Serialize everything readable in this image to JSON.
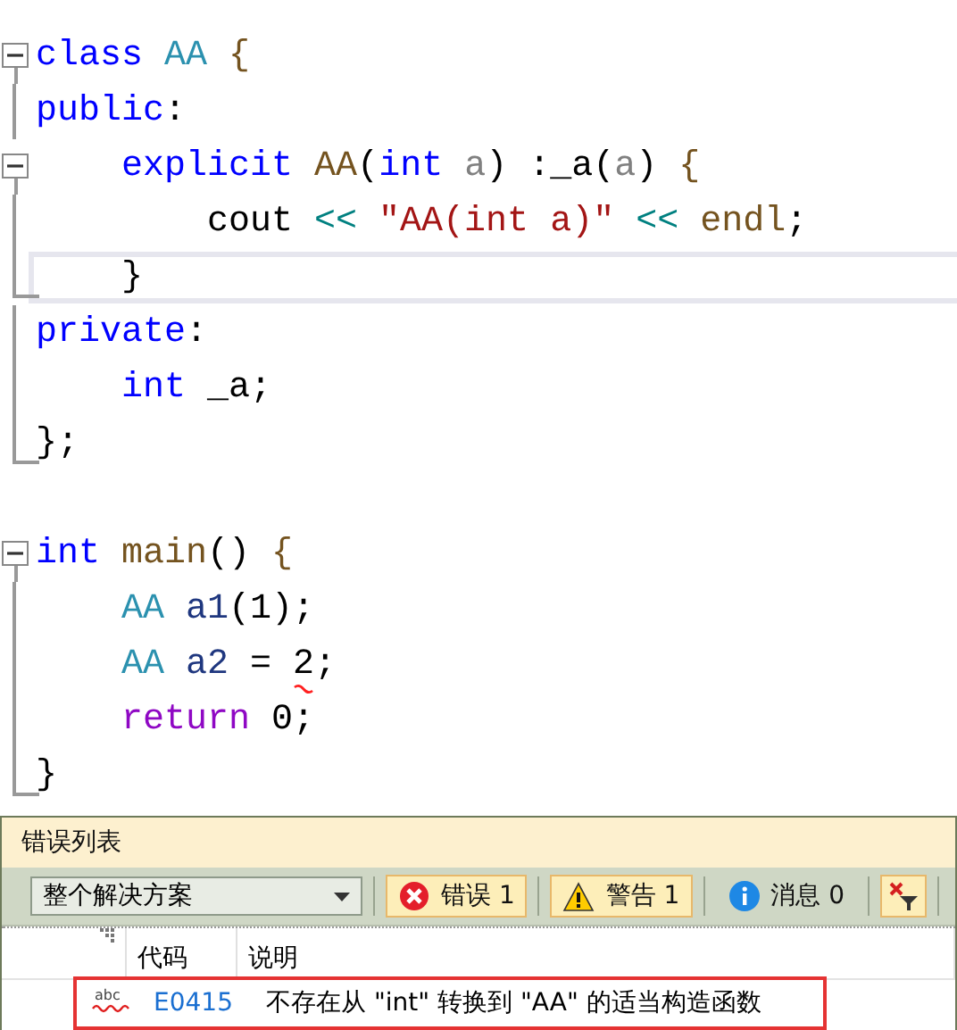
{
  "code": {
    "lines": [
      {
        "kind": "fold_start",
        "current": false,
        "tokens": [
          {
            "text": "class",
            "kind": "keyword"
          },
          {
            "text": " AA",
            "kind": "type"
          },
          {
            "text": " {",
            "kind": "func"
          }
        ]
      },
      {
        "kind": "fold_body",
        "current": false,
        "tokens": [
          {
            "text": "public",
            "kind": "keyword"
          },
          {
            "text": ":"
          }
        ]
      },
      {
        "kind": "fold_start",
        "current": false,
        "tokens": [
          {
            "text": "    explicit",
            "kind": "keyword"
          },
          {
            "text": " AA",
            "kind": "func"
          },
          {
            "text": "("
          },
          {
            "text": "int",
            "kind": "keyword"
          },
          {
            "text": " a",
            "kind": "param"
          },
          {
            "text": ") :_a("
          },
          {
            "text": "a",
            "kind": "param"
          },
          {
            "text": ") "
          },
          {
            "text": "{",
            "kind": "func"
          }
        ]
      },
      {
        "kind": "fold_body",
        "current": false,
        "tokens": [
          {
            "text": "        cout "
          },
          {
            "text": "<<",
            "kind": "operator"
          },
          {
            "text": " \"AA(int a)\"",
            "kind": "string"
          },
          {
            "text": " <<",
            "kind": "operator"
          },
          {
            "text": " endl",
            "kind": "func"
          },
          {
            "text": ";"
          }
        ]
      },
      {
        "kind": "fold_end",
        "current": true,
        "tokens": [
          {
            "text": "    }"
          }
        ]
      },
      {
        "kind": "fold_body",
        "current": false,
        "tokens": [
          {
            "text": "private",
            "kind": "keyword"
          },
          {
            "text": ":"
          }
        ]
      },
      {
        "kind": "fold_body",
        "current": false,
        "tokens": [
          {
            "text": "    int",
            "kind": "keyword"
          },
          {
            "text": " _a;"
          }
        ]
      },
      {
        "kind": "fold_end",
        "current": false,
        "tokens": [
          {
            "text": "};"
          }
        ]
      },
      {
        "kind": "plain",
        "current": false
      },
      {
        "kind": "fold_start",
        "current": false,
        "tokens": [
          {
            "text": "int",
            "kind": "keyword"
          },
          {
            "text": " main",
            "kind": "func"
          },
          {
            "text": "() "
          },
          {
            "text": "{",
            "kind": "func"
          }
        ]
      },
      {
        "kind": "fold_body",
        "current": false,
        "tokens": [
          {
            "text": "    AA",
            "kind": "type"
          },
          {
            "text": " a1",
            "kind": "var"
          },
          {
            "text": "(1);"
          }
        ]
      },
      {
        "kind": "fold_body",
        "current": false,
        "tokens": [
          {
            "text": "    AA",
            "kind": "type"
          },
          {
            "text": " a2",
            "kind": "var"
          },
          {
            "text": " = "
          },
          {
            "text": "2",
            "kind": "error"
          },
          {
            "text": ";"
          }
        ]
      },
      {
        "kind": "fold_body",
        "current": false,
        "tokens": [
          {
            "text": "    return",
            "kind": "control"
          },
          {
            "text": " 0;"
          }
        ]
      },
      {
        "kind": "fold_end",
        "current": false,
        "tokens": [
          {
            "text": "}"
          }
        ]
      }
    ]
  },
  "error_list": {
    "title": "错误列表",
    "scope_dropdown": {
      "value": "整个解决方案"
    },
    "filters": [
      {
        "kind": "error",
        "label": "错误 1",
        "selected": true
      },
      {
        "kind": "warning",
        "label": "警告 1",
        "selected": true
      },
      {
        "kind": "info",
        "label": "消息 0",
        "selected": false
      }
    ],
    "columns": [
      "代码",
      "说明"
    ],
    "rows": [
      {
        "kind": "spelling",
        "icon_text": "abc",
        "code": "E0415",
        "description": "不存在从 \"int\" 转换到 \"AA\" 的适当构造函数",
        "highlighted": true
      }
    ]
  }
}
